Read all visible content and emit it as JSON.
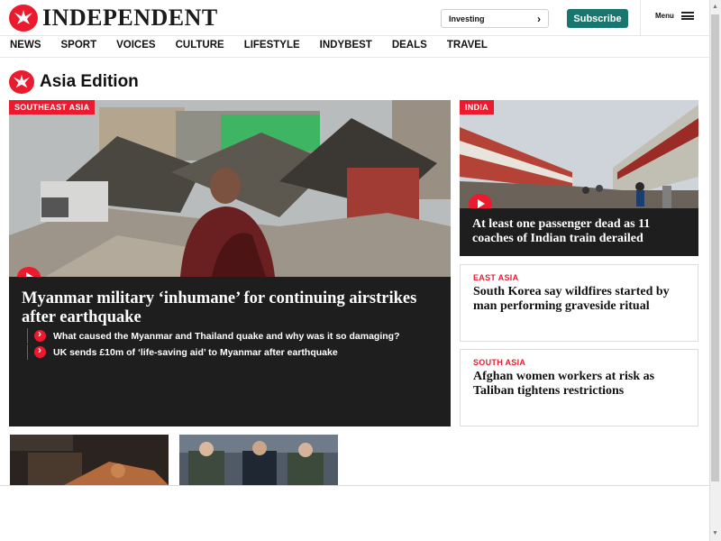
{
  "header": {
    "logo_text": "INDEPENDENT",
    "investing_label": "Investing",
    "subscribe_label": "Subscribe",
    "menu_label": "Menu"
  },
  "nav": {
    "items": [
      "NEWS",
      "SPORT",
      "VOICES",
      "CULTURE",
      "LIFESTYLE",
      "INDYBEST",
      "DEALS",
      "TRAVEL"
    ]
  },
  "section": {
    "title": "Asia Edition"
  },
  "main_story": {
    "category": "SOUTHEAST ASIA",
    "title": "Myanmar military ‘inhumane’ for continuing airstrikes after earthquake",
    "related": [
      "What caused the Myanmar and Thailand quake and why was it so damaging?",
      "UK sends £10m of ‘life-saving aid’ to Myanmar after earthquake"
    ]
  },
  "side_stories": [
    {
      "category": "INDIA",
      "title": "At least one passenger dead as 11 coaches of Indian train derailed"
    },
    {
      "category": "EAST ASIA",
      "title": "South Korea say wildfires started by man performing graveside ritual"
    },
    {
      "category": "SOUTH ASIA",
      "title": "Afghan women workers at risk as Taliban tightens restrictions"
    }
  ],
  "colors": {
    "brand_red": "#ec1a2e",
    "subscribe_green": "#18766f",
    "card_dark": "#1e1e1e"
  },
  "icons": [
    "eagle-logo-icon",
    "chevron-right-icon",
    "hamburger-menu-icon",
    "play-icon",
    "related-arrow-icon"
  ]
}
